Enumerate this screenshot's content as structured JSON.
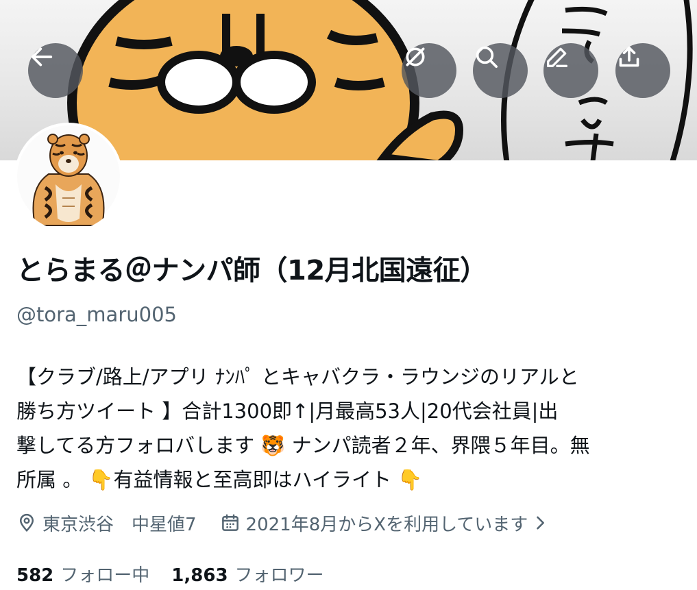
{
  "header": {
    "icons": [
      "back-arrow-icon",
      "grok-icon",
      "search-icon",
      "edit-icon",
      "share-icon"
    ]
  },
  "profile": {
    "display_name": "とらまる＠ナンパ師（12月北国遠征）",
    "handle": "@tora_maru005",
    "bio_lines": [
      "【クラブ/路上/アプリ ﾅﾝﾊﾟ とキャバクラ・ラウンジのリアルと",
      "勝ち方ツイート 】合計1300即↑|月最高53人|20代会社員|出",
      "撃してる方フォロバします 🐯 ナンパ読者２年、界隈５年目。無",
      "所属 。 👇有益情報と至高即はハイライト 👇"
    ],
    "location": "東京渋谷　中星値7",
    "joined": "2021年8月からXを利用しています",
    "following_count": "582",
    "following_label": "フォロー中",
    "followers_count": "1,863",
    "followers_label": "フォロワー"
  },
  "colors": {
    "text_primary": "#0f1419",
    "text_secondary": "#536471",
    "button_overlay": "#53575e",
    "tiger_orange": "#f2b457"
  }
}
